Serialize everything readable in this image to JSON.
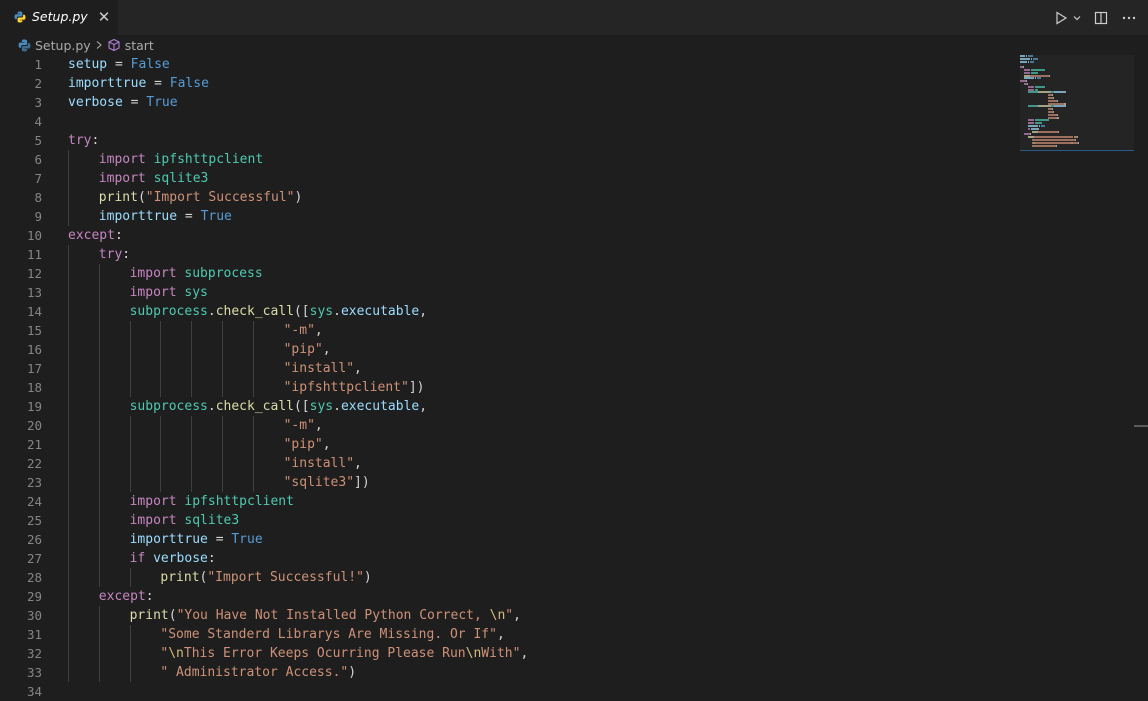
{
  "tab": {
    "filename": "Setup.py"
  },
  "breadcrumb": {
    "file": "Setup.py",
    "symbol": "start"
  },
  "icons": {
    "file": "python-file-icon",
    "close": "close-icon",
    "run": "run-icon",
    "run_menu": "chevron-down-icon",
    "split": "split-editor-icon",
    "more": "more-actions-icon",
    "symbol": "cube-icon",
    "separator": "chevron-right-icon"
  },
  "colors": {
    "keyword": "#c586c0",
    "variable": "#9cdcfe",
    "constant": "#569cd6",
    "module": "#4ec9b0",
    "function": "#dcdcaa",
    "string": "#ce9178",
    "escape": "#d7ba7d",
    "plain": "#d4d4d4",
    "linenumber": "#858585",
    "background": "#1e1e1e"
  },
  "lines": [
    {
      "n": "1",
      "indent": 0,
      "tokens": [
        [
          "var",
          "setup"
        ],
        [
          "plain",
          " = "
        ],
        [
          "const",
          "False"
        ]
      ]
    },
    {
      "n": "2",
      "indent": 0,
      "tokens": [
        [
          "var",
          "importtrue"
        ],
        [
          "plain",
          " = "
        ],
        [
          "const",
          "False"
        ]
      ]
    },
    {
      "n": "3",
      "indent": 0,
      "tokens": [
        [
          "var",
          "verbose"
        ],
        [
          "plain",
          " = "
        ],
        [
          "const",
          "True"
        ]
      ]
    },
    {
      "n": "4",
      "indent": 0,
      "tokens": []
    },
    {
      "n": "5",
      "indent": 0,
      "tokens": [
        [
          "ctrl",
          "try"
        ],
        [
          "plain",
          ":"
        ]
      ]
    },
    {
      "n": "6",
      "indent": 1,
      "tokens": [
        [
          "kw",
          "import"
        ],
        [
          "plain",
          " "
        ],
        [
          "mod",
          "ipfshttpclient"
        ]
      ]
    },
    {
      "n": "7",
      "indent": 1,
      "tokens": [
        [
          "kw",
          "import"
        ],
        [
          "plain",
          " "
        ],
        [
          "mod",
          "sqlite3"
        ]
      ]
    },
    {
      "n": "8",
      "indent": 1,
      "tokens": [
        [
          "fn",
          "print"
        ],
        [
          "plain",
          "("
        ],
        [
          "str",
          "\"Import Successful\""
        ],
        [
          "plain",
          ")"
        ]
      ]
    },
    {
      "n": "9",
      "indent": 1,
      "tokens": [
        [
          "var",
          "importtrue"
        ],
        [
          "plain",
          " = "
        ],
        [
          "const",
          "True"
        ]
      ]
    },
    {
      "n": "10",
      "indent": 0,
      "tokens": [
        [
          "ctrl",
          "except"
        ],
        [
          "plain",
          ":"
        ]
      ]
    },
    {
      "n": "11",
      "indent": 1,
      "tokens": [
        [
          "ctrl",
          "try"
        ],
        [
          "plain",
          ":"
        ]
      ]
    },
    {
      "n": "12",
      "indent": 2,
      "tokens": [
        [
          "kw",
          "import"
        ],
        [
          "plain",
          " "
        ],
        [
          "mod",
          "subprocess"
        ]
      ]
    },
    {
      "n": "13",
      "indent": 2,
      "tokens": [
        [
          "kw",
          "import"
        ],
        [
          "plain",
          " "
        ],
        [
          "mod",
          "sys"
        ]
      ]
    },
    {
      "n": "14",
      "indent": 2,
      "tokens": [
        [
          "mod",
          "subprocess"
        ],
        [
          "plain",
          "."
        ],
        [
          "fn",
          "check_call"
        ],
        [
          "plain",
          "(["
        ],
        [
          "mod",
          "sys"
        ],
        [
          "plain",
          "."
        ],
        [
          "var",
          "executable"
        ],
        [
          "plain",
          ","
        ]
      ]
    },
    {
      "n": "15",
      "indent": 7,
      "tokens": [
        [
          "str",
          "\"-m\""
        ],
        [
          "plain",
          ","
        ]
      ]
    },
    {
      "n": "16",
      "indent": 7,
      "tokens": [
        [
          "str",
          "\"pip\""
        ],
        [
          "plain",
          ","
        ]
      ]
    },
    {
      "n": "17",
      "indent": 7,
      "tokens": [
        [
          "str",
          "\"install\""
        ],
        [
          "plain",
          ","
        ]
      ]
    },
    {
      "n": "18",
      "indent": 7,
      "tokens": [
        [
          "str",
          "\"ipfshttpclient\""
        ],
        [
          "plain",
          "])"
        ]
      ]
    },
    {
      "n": "19",
      "indent": 2,
      "tokens": [
        [
          "mod",
          "subprocess"
        ],
        [
          "plain",
          "."
        ],
        [
          "fn",
          "check_call"
        ],
        [
          "plain",
          "(["
        ],
        [
          "mod",
          "sys"
        ],
        [
          "plain",
          "."
        ],
        [
          "var",
          "executable"
        ],
        [
          "plain",
          ","
        ]
      ]
    },
    {
      "n": "20",
      "indent": 7,
      "tokens": [
        [
          "str",
          "\"-m\""
        ],
        [
          "plain",
          ","
        ]
      ]
    },
    {
      "n": "21",
      "indent": 7,
      "tokens": [
        [
          "str",
          "\"pip\""
        ],
        [
          "plain",
          ","
        ]
      ]
    },
    {
      "n": "22",
      "indent": 7,
      "tokens": [
        [
          "str",
          "\"install\""
        ],
        [
          "plain",
          ","
        ]
      ]
    },
    {
      "n": "23",
      "indent": 7,
      "tokens": [
        [
          "str",
          "\"sqlite3\""
        ],
        [
          "plain",
          "])"
        ]
      ]
    },
    {
      "n": "24",
      "indent": 2,
      "tokens": [
        [
          "kw",
          "import"
        ],
        [
          "plain",
          " "
        ],
        [
          "mod",
          "ipfshttpclient"
        ]
      ]
    },
    {
      "n": "25",
      "indent": 2,
      "tokens": [
        [
          "kw",
          "import"
        ],
        [
          "plain",
          " "
        ],
        [
          "mod",
          "sqlite3"
        ]
      ]
    },
    {
      "n": "26",
      "indent": 2,
      "tokens": [
        [
          "var",
          "importtrue"
        ],
        [
          "plain",
          " = "
        ],
        [
          "const",
          "True"
        ]
      ]
    },
    {
      "n": "27",
      "indent": 2,
      "tokens": [
        [
          "ctrl",
          "if"
        ],
        [
          "plain",
          " "
        ],
        [
          "var",
          "verbose"
        ],
        [
          "plain",
          ":"
        ]
      ]
    },
    {
      "n": "28",
      "indent": 3,
      "tokens": [
        [
          "fn",
          "print"
        ],
        [
          "plain",
          "("
        ],
        [
          "str",
          "\"Import Successful!\""
        ],
        [
          "plain",
          ")"
        ]
      ]
    },
    {
      "n": "29",
      "indent": 1,
      "tokens": [
        [
          "ctrl",
          "except"
        ],
        [
          "plain",
          ":"
        ]
      ]
    },
    {
      "n": "30",
      "indent": 2,
      "tokens": [
        [
          "fn",
          "print"
        ],
        [
          "plain",
          "("
        ],
        [
          "str",
          "\"You Have Not Installed Python Correct, "
        ],
        [
          "esc",
          "\\n"
        ],
        [
          "str",
          "\""
        ],
        [
          "plain",
          ","
        ]
      ]
    },
    {
      "n": "31",
      "indent": 3,
      "tokens": [
        [
          "str",
          "\"Some Standerd Librarys Are Missing. Or If\""
        ],
        [
          "plain",
          ","
        ]
      ]
    },
    {
      "n": "32",
      "indent": 3,
      "tokens": [
        [
          "str",
          "\""
        ],
        [
          "esc",
          "\\n"
        ],
        [
          "str",
          "This Error Keeps Ocurring Please Run"
        ],
        [
          "esc",
          "\\n"
        ],
        [
          "str",
          "With\""
        ],
        [
          "plain",
          ","
        ]
      ]
    },
    {
      "n": "33",
      "indent": 3,
      "tokens": [
        [
          "str",
          "\" Administrator Access.\""
        ],
        [
          "plain",
          ")"
        ]
      ]
    },
    {
      "n": "34",
      "indent": 0,
      "tokens": []
    }
  ]
}
